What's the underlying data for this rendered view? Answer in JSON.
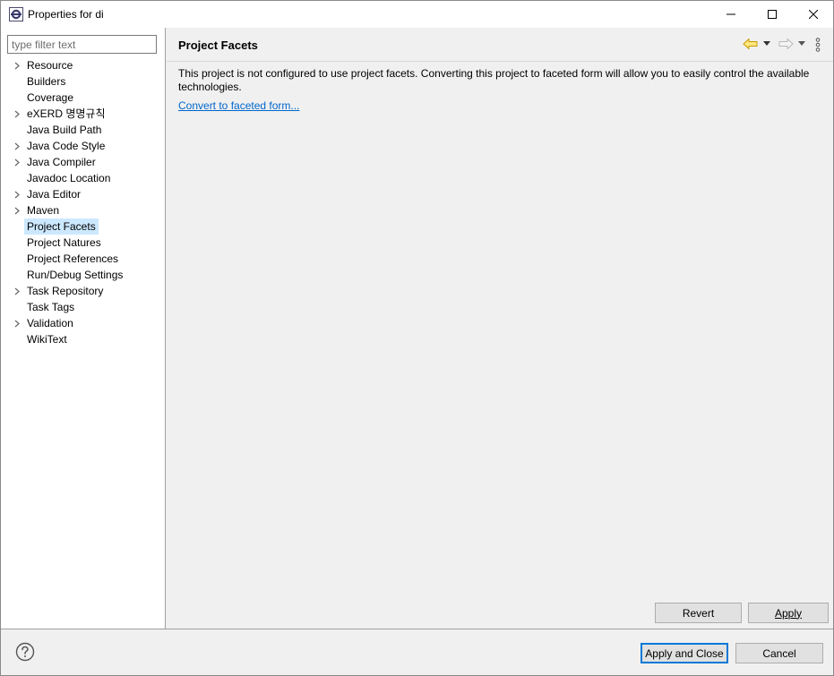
{
  "window": {
    "title": "Properties for di",
    "icon": "eclipse-project-icon"
  },
  "sidebar": {
    "filter_placeholder": "type filter text",
    "filter_value": "",
    "items": [
      {
        "label": "Resource",
        "expandable": true,
        "selected": false
      },
      {
        "label": "Builders",
        "expandable": false,
        "selected": false
      },
      {
        "label": "Coverage",
        "expandable": false,
        "selected": false
      },
      {
        "label": "eXERD 명명규칙",
        "expandable": true,
        "selected": false
      },
      {
        "label": "Java Build Path",
        "expandable": false,
        "selected": false
      },
      {
        "label": "Java Code Style",
        "expandable": true,
        "selected": false
      },
      {
        "label": "Java Compiler",
        "expandable": true,
        "selected": false
      },
      {
        "label": "Javadoc Location",
        "expandable": false,
        "selected": false
      },
      {
        "label": "Java Editor",
        "expandable": true,
        "selected": false
      },
      {
        "label": "Maven",
        "expandable": true,
        "selected": false
      },
      {
        "label": "Project Facets",
        "expandable": false,
        "selected": true
      },
      {
        "label": "Project Natures",
        "expandable": false,
        "selected": false
      },
      {
        "label": "Project References",
        "expandable": false,
        "selected": false
      },
      {
        "label": "Run/Debug Settings",
        "expandable": false,
        "selected": false
      },
      {
        "label": "Task Repository",
        "expandable": true,
        "selected": false
      },
      {
        "label": "Task Tags",
        "expandable": false,
        "selected": false
      },
      {
        "label": "Validation",
        "expandable": true,
        "selected": false
      },
      {
        "label": "WikiText",
        "expandable": false,
        "selected": false
      }
    ]
  },
  "main": {
    "title": "Project Facets",
    "description": "This project is not configured to use project facets. Converting this project to faceted form will allow you to easily control the available technologies.",
    "convert_link": "Convert to faceted form...",
    "revert_label": "Revert",
    "apply_label": "Apply"
  },
  "footer": {
    "apply_close_label": "Apply and Close",
    "cancel_label": "Cancel"
  },
  "colors": {
    "selection": "#cce8ff",
    "link": "#0066cc",
    "nav_back_arrow": "#e8b800",
    "nav_fwd_arrow": "#b8b8b8",
    "default_button_border": "#0078d7"
  }
}
